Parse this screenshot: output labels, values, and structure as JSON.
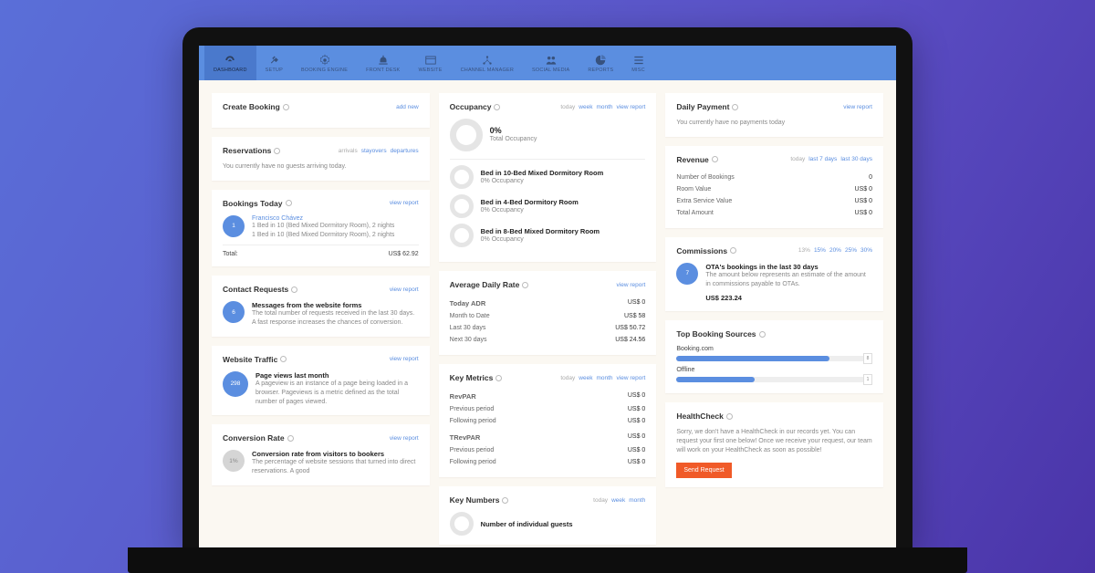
{
  "nav": [
    {
      "label": "DASHBOARD"
    },
    {
      "label": "SETUP"
    },
    {
      "label": "BOOKING ENGINE"
    },
    {
      "label": "FRONT DESK"
    },
    {
      "label": "WEBSITE"
    },
    {
      "label": "CHANNEL MANAGER"
    },
    {
      "label": "SOCIAL MEDIA"
    },
    {
      "label": "REPORTS"
    },
    {
      "label": "MISC"
    }
  ],
  "createBooking": {
    "title": "Create Booking",
    "link": "add new"
  },
  "reservations": {
    "title": "Reservations",
    "tabs": {
      "a": "arrivals",
      "b": "stayovers",
      "c": "departures"
    },
    "msg": "You currently have no guests arriving today."
  },
  "bookingsToday": {
    "title": "Bookings Today",
    "link": "view report",
    "badge": "1",
    "name": "Francisco Chávez",
    "line1": "1 Bed in 10 (Bed Mixed Dormitory Room), 2 nights",
    "line2": "1 Bed in 10 (Bed Mixed Dormitory Room), 2 nights",
    "totalLabel": "Total:",
    "totalVal": "US$ 62.92"
  },
  "contactRequests": {
    "title": "Contact Requests",
    "link": "view report",
    "badge": "6",
    "heading": "Messages from the website forms",
    "desc": "The total number of requests received in the last 30 days. A fast response increases the chances of conversion."
  },
  "websiteTraffic": {
    "title": "Website Traffic",
    "link": "view report",
    "badge": "298",
    "heading": "Page views last month",
    "desc": "A pageview is an instance of a page being loaded in a browser. Pageviews is a metric defined as the total number of pages viewed."
  },
  "conversionRate": {
    "title": "Conversion Rate",
    "link": "view report",
    "badge": "1%",
    "heading": "Conversion rate from visitors to bookers",
    "desc": "The percentage of website sessions that turned into direct reservations. A good"
  },
  "occupancy": {
    "title": "Occupancy",
    "tabs": {
      "a": "today",
      "b": "week",
      "c": "month",
      "d": "view report"
    },
    "total_pct": "0%",
    "total_label": "Total Occupancy",
    "rooms": [
      {
        "name": "Bed in 10-Bed Mixed Dormitory Room",
        "pct": "0% Occupancy"
      },
      {
        "name": "Bed in 4-Bed Dormitory Room",
        "pct": "0% Occupancy"
      },
      {
        "name": "Bed in 8-Bed Mixed Dormitory Room",
        "pct": "0% Occupancy"
      }
    ]
  },
  "adr": {
    "title": "Average Daily Rate",
    "link": "view report",
    "rows": [
      {
        "k": "Today ADR",
        "v": "US$ 0"
      },
      {
        "k": "Month to Date",
        "v": "US$ 58"
      },
      {
        "k": "Last 30 days",
        "v": "US$ 50.72"
      },
      {
        "k": "Next 30 days",
        "v": "US$ 24.56"
      }
    ]
  },
  "keyMetrics": {
    "title": "Key Metrics",
    "tabs": {
      "a": "today",
      "b": "week",
      "c": "month",
      "d": "view report"
    },
    "rows": [
      {
        "k": "RevPAR",
        "v": "US$ 0",
        "strong": true
      },
      {
        "k": "Previous period",
        "v": "US$ 0"
      },
      {
        "k": "Following period",
        "v": "US$ 0"
      },
      {
        "k": "TRevPAR",
        "v": "US$ 0",
        "strong": true
      },
      {
        "k": "Previous period",
        "v": "US$ 0"
      },
      {
        "k": "Following period",
        "v": "US$ 0"
      }
    ]
  },
  "keyNumbers": {
    "title": "Key Numbers",
    "tabs": {
      "a": "today",
      "b": "week",
      "c": "month"
    },
    "first": "Number of individual guests"
  },
  "dailyPayment": {
    "title": "Daily Payment",
    "link": "view report",
    "msg": "You currently have no payments today"
  },
  "revenue": {
    "title": "Revenue",
    "tabs": {
      "a": "today",
      "b": "last 7 days",
      "c": "last 30 days"
    },
    "rows": [
      {
        "k": "Number of Bookings",
        "v": "0"
      },
      {
        "k": "Room Value",
        "v": "US$ 0"
      },
      {
        "k": "Extra Service Value",
        "v": "US$ 0"
      },
      {
        "k": "Total Amount",
        "v": "US$ 0"
      }
    ]
  },
  "commissions": {
    "title": "Commissions",
    "tabs": {
      "a": "13%",
      "b": "15%",
      "c": "20%",
      "d": "25%",
      "e": "30%"
    },
    "badge": "7",
    "heading": "OTA's bookings in the last 30 days",
    "desc": "The amount below represents an estimate of the amount in commissions payable to OTAs.",
    "value": "US$ 223.24"
  },
  "topSources": {
    "title": "Top Booking Sources",
    "rows": [
      {
        "name": "Booking.com",
        "pct": 78,
        "count": "8"
      },
      {
        "name": "Offline",
        "pct": 40,
        "count": "1"
      }
    ]
  },
  "healthCheck": {
    "title": "HealthCheck",
    "desc": "Sorry, we don't have a HealthCheck in our records yet. You can request your first one below! Once we receive your request, our team will work on your HealthCheck as soon as possible!",
    "button": "Send Request"
  }
}
